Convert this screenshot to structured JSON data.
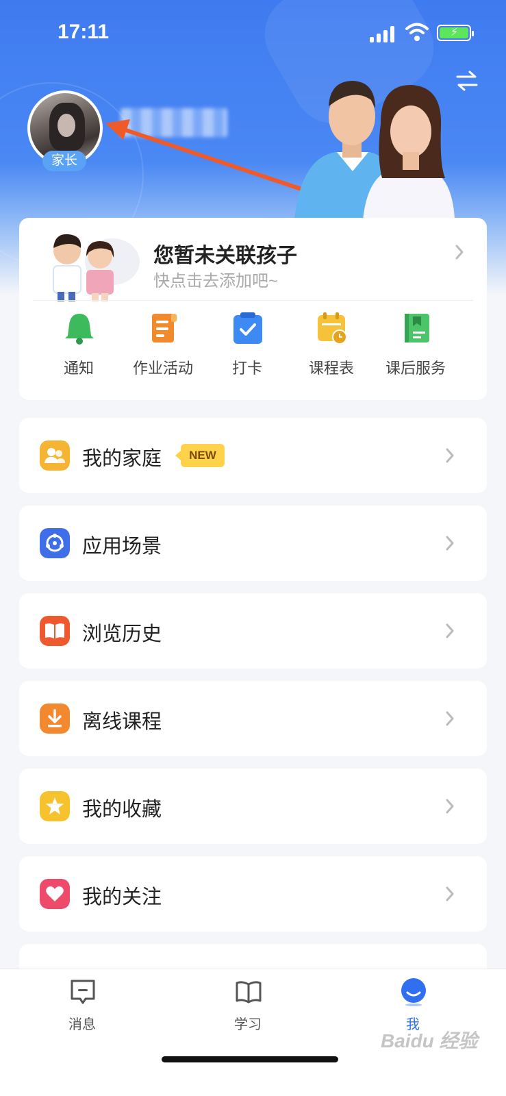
{
  "status_bar": {
    "time": "17:11"
  },
  "profile": {
    "role_badge": "家长"
  },
  "child_card": {
    "title": "您暂未关联孩子",
    "subtitle": "快点击去添加吧~"
  },
  "shortcuts": [
    {
      "label": "通知",
      "icon": "bell-icon"
    },
    {
      "label": "作业活动",
      "icon": "homework-scroll-icon"
    },
    {
      "label": "打卡",
      "icon": "checkin-calendar-icon"
    },
    {
      "label": "课程表",
      "icon": "schedule-icon"
    },
    {
      "label": "课后服务",
      "icon": "after-school-book-icon"
    }
  ],
  "menu": [
    {
      "label": "我的家庭",
      "icon": "family-icon",
      "badge": "NEW"
    },
    {
      "label": "应用场景",
      "icon": "scenario-icon"
    },
    {
      "label": "浏览历史",
      "icon": "history-book-icon"
    },
    {
      "label": "离线课程",
      "icon": "download-icon"
    },
    {
      "label": "我的收藏",
      "icon": "star-icon"
    },
    {
      "label": "我的关注",
      "icon": "heart-icon"
    }
  ],
  "tabbar": {
    "tabs": [
      {
        "label": "消息",
        "icon": "message-icon"
      },
      {
        "label": "学习",
        "icon": "book-icon"
      },
      {
        "label": "我",
        "icon": "profile-icon",
        "active": true
      }
    ]
  },
  "watermark": "Baidu 经验",
  "colors": {
    "accent": "#2f6ff0",
    "header_blue": "#3f7bf0",
    "annotation_arrow": "#f05a28",
    "new_badge": "#ffd24a"
  }
}
